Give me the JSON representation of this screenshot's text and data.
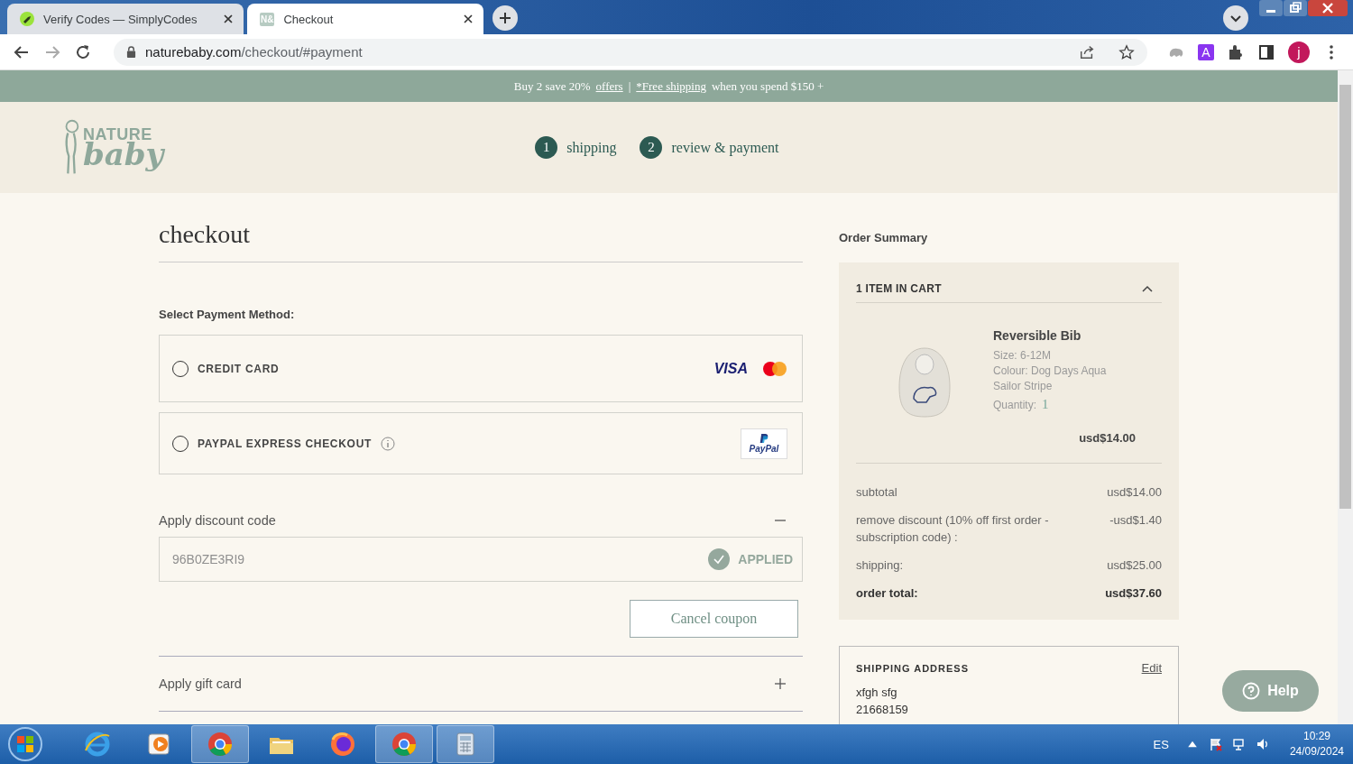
{
  "browser": {
    "tabs": [
      {
        "title": "Verify Codes — SimplyCodes",
        "selected": false,
        "kind": "simplycodes"
      },
      {
        "title": "Checkout",
        "selected": true,
        "kind": "site",
        "favicon_text": "N&"
      }
    ],
    "url_host": "naturebaby.com",
    "url_path": "/checkout/#payment",
    "extension_letter": "A",
    "profile_initial": "j"
  },
  "promo": {
    "lead": "Buy 2 save 20%",
    "link_1": "offers",
    "separator": "|",
    "link_2": "*Free shipping",
    "tail": "when you spend $150 +"
  },
  "logo": {
    "line_1": "NATURE",
    "line_2": "baby"
  },
  "steps": [
    {
      "number": "1",
      "label": "shipping"
    },
    {
      "number": "2",
      "label": "review & payment"
    }
  ],
  "checkout": {
    "title": "checkout",
    "section_label": "Select Payment Method:",
    "payment_methods": [
      {
        "kind": "card",
        "label": "CREDIT CARD",
        "selected": false,
        "logo_text": "VISA"
      },
      {
        "kind": "paypal",
        "label": "PAYPAL EXPRESS CHECKOUT",
        "selected": false,
        "logo_text": "PayPal"
      }
    ],
    "discount": {
      "label": "Apply discount code",
      "expanded": true,
      "value": "96B0ZE3RI9",
      "status": "APPLIED",
      "button": "Cancel coupon"
    },
    "gift_card": {
      "label": "Apply gift card",
      "expanded": false
    }
  },
  "order_summary": {
    "title": "Order Summary",
    "cart_header": "1 ITEM IN CART",
    "expanded": true,
    "item": {
      "name": "Reversible Bib",
      "details": [
        "Size: 6-12M",
        "Colour: Dog Days Aqua Sailor Stripe"
      ],
      "quantity_label": "Quantity:",
      "quantity": "1",
      "price": "usd$14.00"
    },
    "totals": [
      {
        "kind": "line",
        "label": "subtotal",
        "value": "usd$14.00"
      },
      {
        "kind": "line",
        "label": "remove discount (10% off first order - subscription code)  :",
        "value": "-usd$1.40"
      },
      {
        "kind": "line",
        "label": "shipping:",
        "value": "usd$25.00"
      },
      {
        "kind": "total",
        "label": "order total:",
        "value": "usd$37.60"
      }
    ]
  },
  "shipping_address": {
    "title": "SHIPPING ADDRESS",
    "edit": "Edit",
    "lines": [
      "xfgh sfg",
      "21668159"
    ]
  },
  "help": {
    "label": "Help"
  },
  "taskbar": {
    "apps": [
      {
        "kind": "ie",
        "active": false
      },
      {
        "kind": "media",
        "active": false
      },
      {
        "kind": "chrome",
        "active": true
      },
      {
        "kind": "folder",
        "active": false
      },
      {
        "kind": "firefox",
        "active": false
      },
      {
        "kind": "chrome",
        "active": true
      },
      {
        "kind": "calculator",
        "active": true
      }
    ],
    "language": "ES",
    "time": "10:29",
    "date": "24/09/2024"
  }
}
